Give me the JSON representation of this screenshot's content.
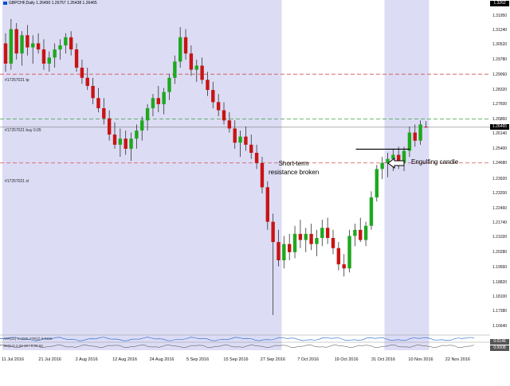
{
  "chart": {
    "title": "GBPCHF,Daily  1.26490 1.26757 1.26438 1.26465",
    "current_price": "1.26465",
    "top_badge": "1.3262",
    "candle_color_up": "#1ea81e",
    "candle_color_down": "#c81414",
    "zone_color": "#dcdcf5"
  },
  "lines": {
    "tp_label": "#17257021 tp",
    "buy_label": "#17257021 buy 0.05",
    "sl_label": "#17257021 sl"
  },
  "annotations": {
    "resistance_line1": "Short-term",
    "resistance_line2": "resistance broken",
    "engulfing": "Engulfing candle"
  },
  "price_axis": [
    "1.31950",
    "1.31240",
    "1.30520",
    "1.29780",
    "1.29060",
    "1.28320",
    "1.27600",
    "1.26860",
    "1.26140",
    "1.25400",
    "1.24680",
    "1.23920",
    "1.23200",
    "1.22460",
    "1.21740",
    "1.21020",
    "1.20280",
    "1.19560",
    "1.18820",
    "1.18100",
    "1.17380",
    "1.16640"
  ],
  "time_axis": [
    "11 Jul 2016",
    "21 Jul 2016",
    "2 Aug 2016",
    "12 Aug 2016",
    "24 Aug 2016",
    "5 Sep 2016",
    "15 Sep 2016",
    "27 Sep 2016",
    "7 Oct 2016",
    "19 Oct 2016",
    "31 Oct 2016",
    "10 Nov 2016",
    "22 Nov 2016"
  ],
  "indicators": {
    "atr_label": "ATR(11) 0.0080  ATR(2) 0.0116",
    "osc_label": "SM(14) 0.00 10 / 0.00 50",
    "badge_values": [
      "0.0146",
      "0.0008"
    ]
  },
  "chart_data": {
    "type": "candlestick",
    "ylim": [
      1.1625,
      1.3262
    ],
    "candles": [
      [
        1.306,
        1.311,
        1.292,
        1.296
      ],
      [
        1.296,
        1.318,
        1.293,
        1.313
      ],
      [
        1.313,
        1.316,
        1.298,
        1.301
      ],
      [
        1.301,
        1.312,
        1.295,
        1.31
      ],
      [
        1.31,
        1.315,
        1.3,
        1.304
      ],
      [
        1.304,
        1.31,
        1.296,
        1.306
      ],
      [
        1.306,
        1.311,
        1.301,
        1.303
      ],
      [
        1.303,
        1.308,
        1.293,
        1.296
      ],
      [
        1.296,
        1.302,
        1.292,
        1.299
      ],
      [
        1.299,
        1.306,
        1.294,
        1.303
      ],
      [
        1.303,
        1.308,
        1.298,
        1.305
      ],
      [
        1.305,
        1.311,
        1.301,
        1.309
      ],
      [
        1.309,
        1.312,
        1.3,
        1.303
      ],
      [
        1.303,
        1.306,
        1.292,
        1.294
      ],
      [
        1.294,
        1.298,
        1.286,
        1.289
      ],
      [
        1.289,
        1.294,
        1.283,
        1.285
      ],
      [
        1.285,
        1.289,
        1.276,
        1.279
      ],
      [
        1.279,
        1.284,
        1.272,
        1.274
      ],
      [
        1.274,
        1.279,
        1.266,
        1.269
      ],
      [
        1.269,
        1.273,
        1.258,
        1.261
      ],
      [
        1.261,
        1.267,
        1.254,
        1.256
      ],
      [
        1.256,
        1.264,
        1.25,
        1.259
      ],
      [
        1.259,
        1.263,
        1.251,
        1.254
      ],
      [
        1.254,
        1.262,
        1.248,
        1.259
      ],
      [
        1.259,
        1.266,
        1.254,
        1.263
      ],
      [
        1.263,
        1.27,
        1.258,
        1.268
      ],
      [
        1.268,
        1.276,
        1.263,
        1.274
      ],
      [
        1.274,
        1.281,
        1.27,
        1.279
      ],
      [
        1.279,
        1.285,
        1.272,
        1.276
      ],
      [
        1.276,
        1.284,
        1.271,
        1.282
      ],
      [
        1.282,
        1.291,
        1.278,
        1.289
      ],
      [
        1.289,
        1.3,
        1.286,
        1.297
      ],
      [
        1.297,
        1.314,
        1.294,
        1.309
      ],
      [
        1.309,
        1.313,
        1.298,
        1.301
      ],
      [
        1.301,
        1.305,
        1.29,
        1.293
      ],
      [
        1.293,
        1.298,
        1.287,
        1.295
      ],
      [
        1.295,
        1.299,
        1.286,
        1.288
      ],
      [
        1.288,
        1.292,
        1.28,
        1.283
      ],
      [
        1.283,
        1.287,
        1.274,
        1.277
      ],
      [
        1.277,
        1.281,
        1.27,
        1.273
      ],
      [
        1.273,
        1.277,
        1.266,
        1.268
      ],
      [
        1.268,
        1.272,
        1.262,
        1.264
      ],
      [
        1.264,
        1.268,
        1.254,
        1.257
      ],
      [
        1.257,
        1.263,
        1.25,
        1.26
      ],
      [
        1.26,
        1.265,
        1.253,
        1.256
      ],
      [
        1.256,
        1.261,
        1.249,
        1.252
      ],
      [
        1.252,
        1.256,
        1.244,
        1.247
      ],
      [
        1.247,
        1.25,
        1.232,
        1.235
      ],
      [
        1.235,
        1.238,
        1.214,
        1.218
      ],
      [
        1.218,
        1.222,
        1.172,
        1.208
      ],
      [
        1.208,
        1.214,
        1.196,
        1.199
      ],
      [
        1.199,
        1.211,
        1.195,
        1.207
      ],
      [
        1.207,
        1.212,
        1.199,
        1.203
      ],
      [
        1.203,
        1.216,
        1.2,
        1.212
      ],
      [
        1.212,
        1.219,
        1.205,
        1.209
      ],
      [
        1.209,
        1.215,
        1.203,
        1.212
      ],
      [
        1.212,
        1.217,
        1.204,
        1.207
      ],
      [
        1.207,
        1.214,
        1.201,
        1.21
      ],
      [
        1.21,
        1.219,
        1.206,
        1.215
      ],
      [
        1.215,
        1.22,
        1.207,
        1.21
      ],
      [
        1.21,
        1.214,
        1.202,
        1.205
      ],
      [
        1.205,
        1.208,
        1.194,
        1.197
      ],
      [
        1.197,
        1.202,
        1.191,
        1.195
      ],
      [
        1.195,
        1.214,
        1.193,
        1.211
      ],
      [
        1.211,
        1.217,
        1.206,
        1.214
      ],
      [
        1.214,
        1.22,
        1.208,
        1.209
      ],
      [
        1.209,
        1.218,
        1.206,
        1.216
      ],
      [
        1.216,
        1.233,
        1.214,
        1.23
      ],
      [
        1.23,
        1.246,
        1.228,
        1.244
      ],
      [
        1.244,
        1.25,
        1.239,
        1.247
      ],
      [
        1.247,
        1.252,
        1.24,
        1.249
      ],
      [
        1.249,
        1.254,
        1.243,
        1.251
      ],
      [
        1.251,
        1.255,
        1.244,
        1.247
      ],
      [
        1.247,
        1.255,
        1.243,
        1.253
      ],
      [
        1.253,
        1.265,
        1.25,
        1.262
      ],
      [
        1.262,
        1.266,
        1.255,
        1.258
      ],
      [
        1.258,
        1.268,
        1.256,
        1.266
      ],
      [
        1.2649,
        1.2676,
        1.2644,
        1.26465
      ]
    ],
    "levels": {
      "tp": 1.2908,
      "buy": 1.2687,
      "sl": 1.247,
      "resistance": 1.2538
    },
    "zones": [
      [
        0,
        50
      ],
      [
        70,
        77
      ]
    ]
  }
}
